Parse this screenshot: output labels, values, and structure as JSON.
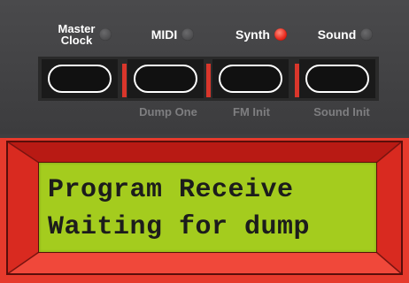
{
  "functions": [
    {
      "label": "Master\nClock",
      "led": "off",
      "sub_label": ""
    },
    {
      "label": "MIDI",
      "led": "off",
      "sub_label": "Dump One"
    },
    {
      "label": "Synth",
      "led": "on",
      "sub_label": "FM Init"
    },
    {
      "label": "Sound",
      "led": "off",
      "sub_label": "Sound Init"
    }
  ],
  "display": {
    "line1": "Program Receive",
    "line2": "Waiting for dump"
  },
  "colors": {
    "panel": "#3f3f41",
    "accent_red": "#e63a2c",
    "led_on": "#e8281c",
    "lcd": "#a4cc1e"
  }
}
